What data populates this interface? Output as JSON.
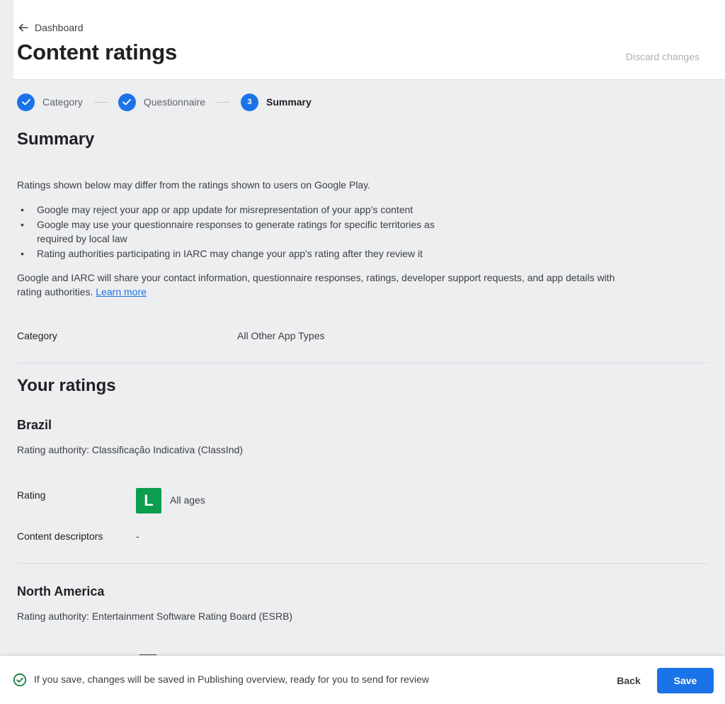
{
  "header": {
    "back_label": "Dashboard",
    "title": "Content ratings",
    "discard_label": "Discard changes"
  },
  "stepper": {
    "steps": [
      {
        "label": "Category",
        "state": "complete"
      },
      {
        "label": "Questionnaire",
        "state": "complete"
      },
      {
        "label": "Summary",
        "state": "active",
        "number": "3"
      }
    ]
  },
  "summary": {
    "heading": "Summary",
    "intro": "Ratings shown below may differ from the ratings shown to users on Google Play.",
    "bullets": [
      "Google may reject your app or app update for misrepresentation of your app’s content",
      "Google may use your questionnaire responses to generate ratings for specific territories as required by local law",
      "Rating authorities participating in IARC may change your app's rating after they review it"
    ],
    "share_text": "Google and IARC will share your contact information, questionnaire responses, ratings, developer support requests, and app details with rating authorities. ",
    "learn_more": "Learn more",
    "category_label": "Category",
    "category_value": "All Other App Types"
  },
  "ratings": {
    "heading": "Your ratings",
    "regions": [
      {
        "name": "Brazil",
        "authority": "Rating authority: Classificação Indicativa (ClassInd)",
        "rating_label": "Rating",
        "badge_letter": "L",
        "badge_color": "#0c9d4f",
        "rating_value": "All ages",
        "descriptors_label": "Content descriptors",
        "descriptors_value": "-"
      },
      {
        "name": "North America",
        "authority": "Rating authority: Entertainment Software Rating Board (ESRB)"
      }
    ]
  },
  "footer": {
    "message": "If you save, changes will be saved in Publishing overview, ready for you to send for review",
    "back_label": "Back",
    "save_label": "Save"
  },
  "colors": {
    "accent": "#1a73e8",
    "success": "#188038",
    "page_bg": "#edeef0"
  }
}
